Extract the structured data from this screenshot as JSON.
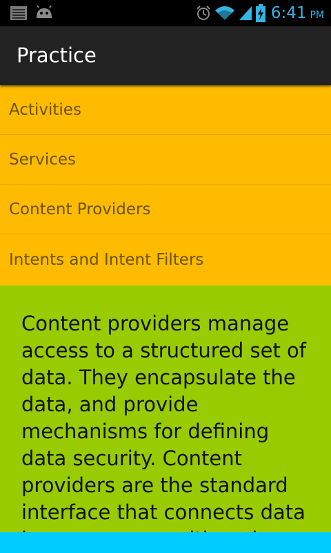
{
  "status_bar": {
    "time": "6:41",
    "ampm": "PM",
    "icons": [
      "notification-icon",
      "android-icon",
      "alarm-icon",
      "wifi-icon",
      "signal-icon",
      "battery-charging-icon"
    ],
    "accent_color": "#33b5e5"
  },
  "action_bar": {
    "title": "Practice"
  },
  "title_list": {
    "background_color": "#ffbb00",
    "items": [
      {
        "label": "Activities"
      },
      {
        "label": "Services"
      },
      {
        "label": "Content Providers"
      },
      {
        "label": "Intents and Intent Filters"
      }
    ]
  },
  "details": {
    "background_color": "#99cc00",
    "text": "Content providers manage access to a structured set of data. They encapsulate the data, and provide mechanisms for defining data security. Content providers are the standard interface that connects data in one process with code running in another process."
  },
  "bottom_strip": {
    "background_color": "#00ccff"
  }
}
